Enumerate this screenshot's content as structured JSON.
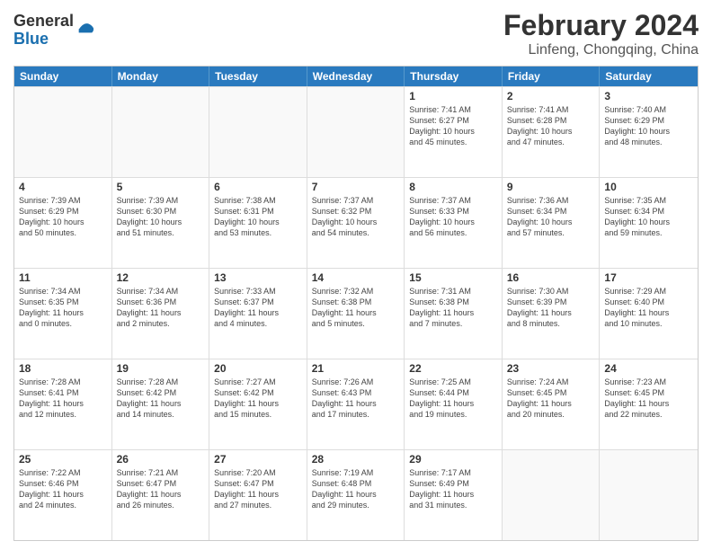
{
  "logo": {
    "general": "General",
    "blue": "Blue"
  },
  "title": "February 2024",
  "location": "Linfeng, Chongqing, China",
  "days_of_week": [
    "Sunday",
    "Monday",
    "Tuesday",
    "Wednesday",
    "Thursday",
    "Friday",
    "Saturday"
  ],
  "weeks": [
    [
      {
        "day": "",
        "info": ""
      },
      {
        "day": "",
        "info": ""
      },
      {
        "day": "",
        "info": ""
      },
      {
        "day": "",
        "info": ""
      },
      {
        "day": "1",
        "info": "Sunrise: 7:41 AM\nSunset: 6:27 PM\nDaylight: 10 hours\nand 45 minutes."
      },
      {
        "day": "2",
        "info": "Sunrise: 7:41 AM\nSunset: 6:28 PM\nDaylight: 10 hours\nand 47 minutes."
      },
      {
        "day": "3",
        "info": "Sunrise: 7:40 AM\nSunset: 6:29 PM\nDaylight: 10 hours\nand 48 minutes."
      }
    ],
    [
      {
        "day": "4",
        "info": "Sunrise: 7:39 AM\nSunset: 6:29 PM\nDaylight: 10 hours\nand 50 minutes."
      },
      {
        "day": "5",
        "info": "Sunrise: 7:39 AM\nSunset: 6:30 PM\nDaylight: 10 hours\nand 51 minutes."
      },
      {
        "day": "6",
        "info": "Sunrise: 7:38 AM\nSunset: 6:31 PM\nDaylight: 10 hours\nand 53 minutes."
      },
      {
        "day": "7",
        "info": "Sunrise: 7:37 AM\nSunset: 6:32 PM\nDaylight: 10 hours\nand 54 minutes."
      },
      {
        "day": "8",
        "info": "Sunrise: 7:37 AM\nSunset: 6:33 PM\nDaylight: 10 hours\nand 56 minutes."
      },
      {
        "day": "9",
        "info": "Sunrise: 7:36 AM\nSunset: 6:34 PM\nDaylight: 10 hours\nand 57 minutes."
      },
      {
        "day": "10",
        "info": "Sunrise: 7:35 AM\nSunset: 6:34 PM\nDaylight: 10 hours\nand 59 minutes."
      }
    ],
    [
      {
        "day": "11",
        "info": "Sunrise: 7:34 AM\nSunset: 6:35 PM\nDaylight: 11 hours\nand 0 minutes."
      },
      {
        "day": "12",
        "info": "Sunrise: 7:34 AM\nSunset: 6:36 PM\nDaylight: 11 hours\nand 2 minutes."
      },
      {
        "day": "13",
        "info": "Sunrise: 7:33 AM\nSunset: 6:37 PM\nDaylight: 11 hours\nand 4 minutes."
      },
      {
        "day": "14",
        "info": "Sunrise: 7:32 AM\nSunset: 6:38 PM\nDaylight: 11 hours\nand 5 minutes."
      },
      {
        "day": "15",
        "info": "Sunrise: 7:31 AM\nSunset: 6:38 PM\nDaylight: 11 hours\nand 7 minutes."
      },
      {
        "day": "16",
        "info": "Sunrise: 7:30 AM\nSunset: 6:39 PM\nDaylight: 11 hours\nand 8 minutes."
      },
      {
        "day": "17",
        "info": "Sunrise: 7:29 AM\nSunset: 6:40 PM\nDaylight: 11 hours\nand 10 minutes."
      }
    ],
    [
      {
        "day": "18",
        "info": "Sunrise: 7:28 AM\nSunset: 6:41 PM\nDaylight: 11 hours\nand 12 minutes."
      },
      {
        "day": "19",
        "info": "Sunrise: 7:28 AM\nSunset: 6:42 PM\nDaylight: 11 hours\nand 14 minutes."
      },
      {
        "day": "20",
        "info": "Sunrise: 7:27 AM\nSunset: 6:42 PM\nDaylight: 11 hours\nand 15 minutes."
      },
      {
        "day": "21",
        "info": "Sunrise: 7:26 AM\nSunset: 6:43 PM\nDaylight: 11 hours\nand 17 minutes."
      },
      {
        "day": "22",
        "info": "Sunrise: 7:25 AM\nSunset: 6:44 PM\nDaylight: 11 hours\nand 19 minutes."
      },
      {
        "day": "23",
        "info": "Sunrise: 7:24 AM\nSunset: 6:45 PM\nDaylight: 11 hours\nand 20 minutes."
      },
      {
        "day": "24",
        "info": "Sunrise: 7:23 AM\nSunset: 6:45 PM\nDaylight: 11 hours\nand 22 minutes."
      }
    ],
    [
      {
        "day": "25",
        "info": "Sunrise: 7:22 AM\nSunset: 6:46 PM\nDaylight: 11 hours\nand 24 minutes."
      },
      {
        "day": "26",
        "info": "Sunrise: 7:21 AM\nSunset: 6:47 PM\nDaylight: 11 hours\nand 26 minutes."
      },
      {
        "day": "27",
        "info": "Sunrise: 7:20 AM\nSunset: 6:47 PM\nDaylight: 11 hours\nand 27 minutes."
      },
      {
        "day": "28",
        "info": "Sunrise: 7:19 AM\nSunset: 6:48 PM\nDaylight: 11 hours\nand 29 minutes."
      },
      {
        "day": "29",
        "info": "Sunrise: 7:17 AM\nSunset: 6:49 PM\nDaylight: 11 hours\nand 31 minutes."
      },
      {
        "day": "",
        "info": ""
      },
      {
        "day": "",
        "info": ""
      }
    ]
  ]
}
